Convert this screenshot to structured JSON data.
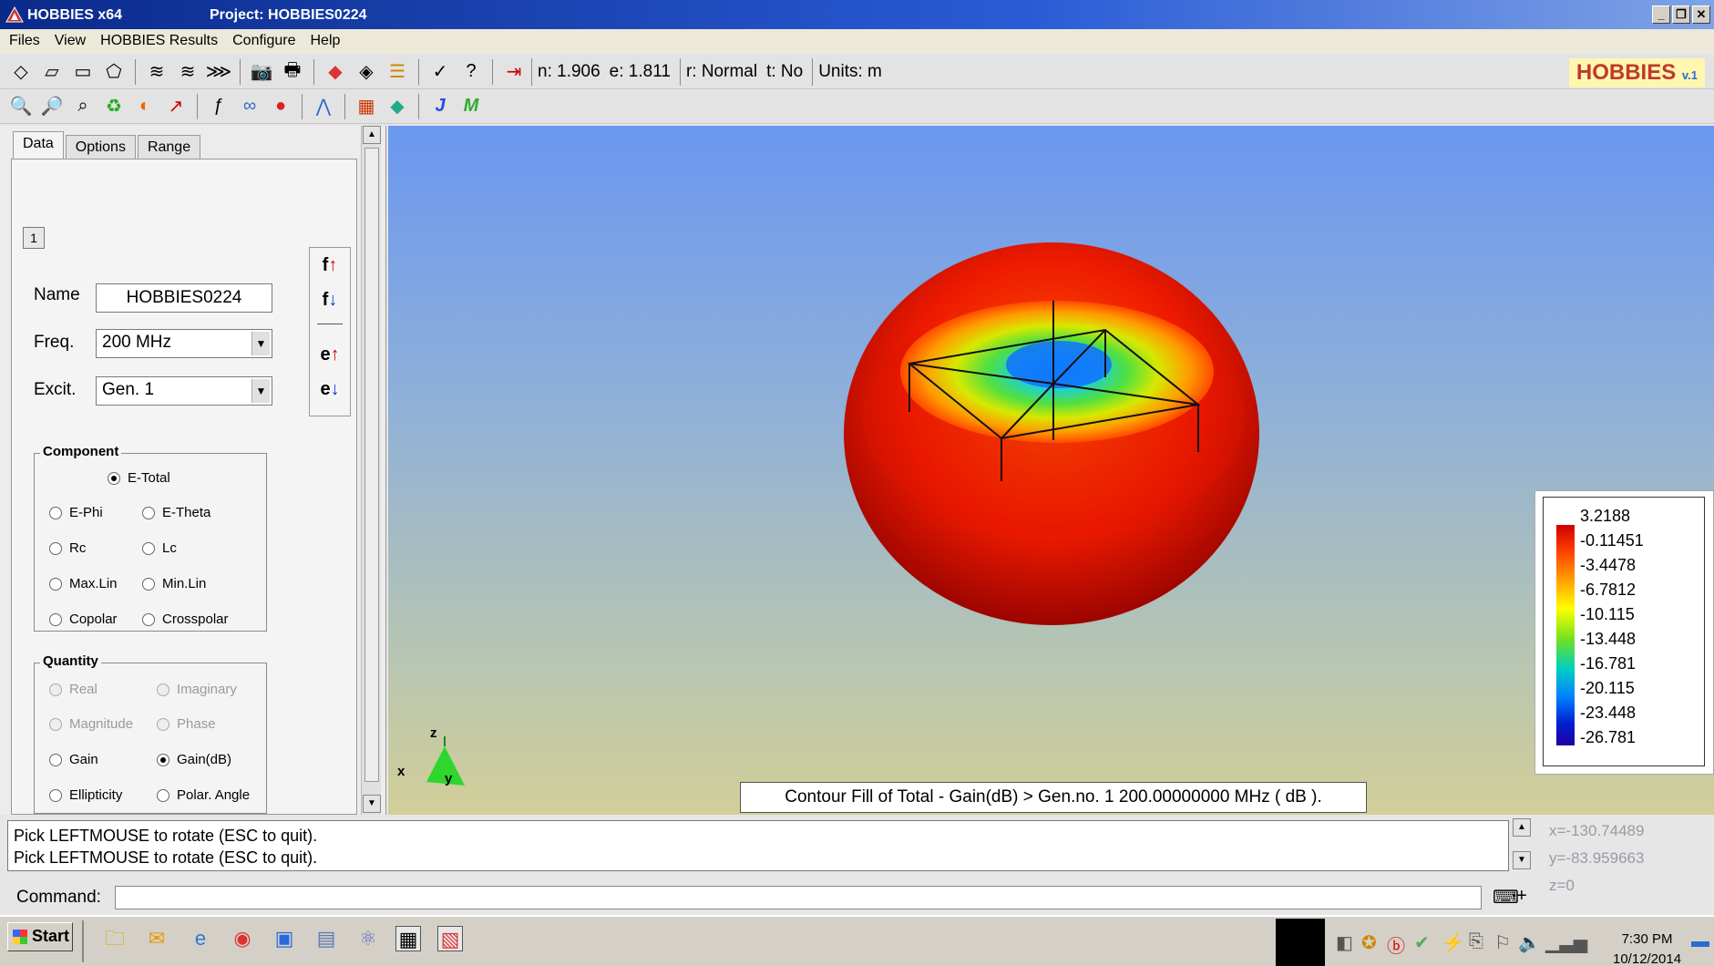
{
  "window": {
    "app_title": "HOBBIES x64",
    "project_title": "Project: HOBBIES0224",
    "min": "_",
    "restore": "❐",
    "close": "✕"
  },
  "menu": [
    "Files",
    "View",
    "HOBBIES Results",
    "Configure",
    "Help"
  ],
  "toolbar": {
    "n_readout": "n: 1.906",
    "e_readout": "e: 1.811",
    "r_readout": "r: Normal",
    "t_readout": "t: No",
    "units": "Units: m",
    "brand": "HOBBIES",
    "brand_version": "v.1"
  },
  "panel": {
    "tabs": [
      "Data",
      "Options",
      "Range"
    ],
    "subtab": "1",
    "name_label": "Name",
    "name_value": "HOBBIES0224",
    "freq_label": "Freq.",
    "freq_value": "200 MHz",
    "excit_label": "Excit.",
    "excit_value": "Gen. 1",
    "f_up": "f",
    "f_down": "f",
    "e_up": "e",
    "e_down": "e",
    "component_label": "Component",
    "components": {
      "etotal": "E-Total",
      "ephi": "E-Phi",
      "etheta": "E-Theta",
      "rc": "Rc",
      "lc": "Lc",
      "maxlin": "Max.Lin",
      "minlin": "Min.Lin",
      "copolar": "Copolar",
      "crosspolar": "Crosspolar"
    },
    "quantity_label": "Quantity",
    "quantities": {
      "real": "Real",
      "imaginary": "Imaginary",
      "magnitude": "Magnitude",
      "phase": "Phase",
      "gain": "Gain",
      "gaindb": "Gain(dB)",
      "ellipticity": "Ellipticity",
      "polar_angle": "Polar. Angle"
    }
  },
  "view": {
    "axis_x": "x",
    "axis_y": "y",
    "axis_z": "z",
    "legend_values": [
      "3.2188",
      "-0.11451",
      "-3.4478",
      "-6.7812",
      "-10.115",
      "-13.448",
      "-16.781",
      "-20.115",
      "-23.448",
      "-26.781"
    ],
    "caption": "Contour Fill of Total - Gain(dB)  >   Gen.no.   1      200.00000000 MHz  ( dB )."
  },
  "messages": {
    "line1": "Pick LEFTMOUSE to rotate (ESC to quit).",
    "line2": "Pick LEFTMOUSE to rotate (ESC to quit)."
  },
  "coords": {
    "x": "x=-130.74489",
    "y": "y=-83.959663",
    "z": "z=0"
  },
  "command": {
    "label": "Command:"
  },
  "taskbar": {
    "start": "Start",
    "time": "7:30 PM",
    "date": "10/12/2014"
  }
}
